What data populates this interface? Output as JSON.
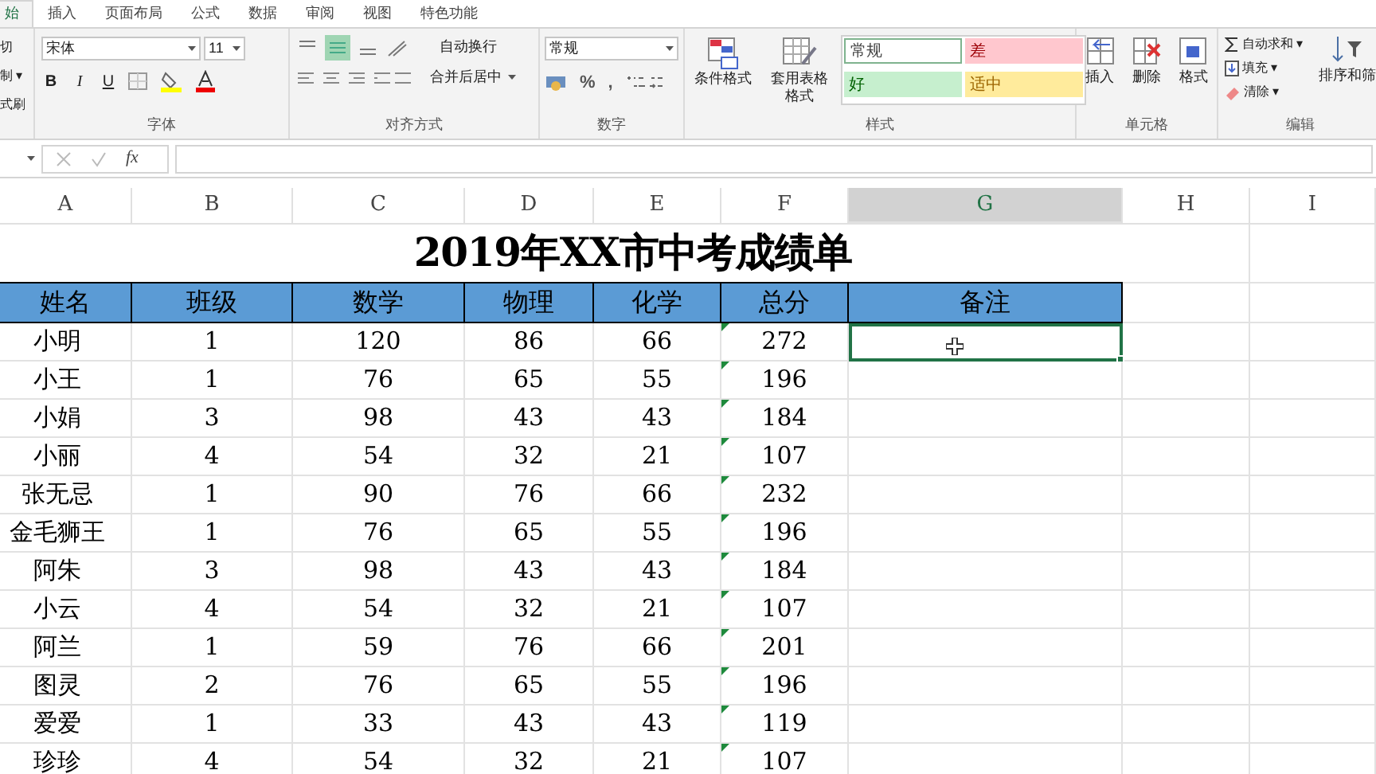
{
  "tabs": [
    {
      "label": "始",
      "selected": true
    },
    {
      "label": "插入",
      "selected": false
    },
    {
      "label": "页面布局",
      "selected": false
    },
    {
      "label": "公式",
      "selected": false
    },
    {
      "label": "数据",
      "selected": false
    },
    {
      "label": "审阅",
      "selected": false
    },
    {
      "label": "视图",
      "selected": false
    },
    {
      "label": "特色功能",
      "selected": false
    }
  ],
  "clipboard": [
    "切",
    "制 ▾",
    "式刷"
  ],
  "font": {
    "name": "宋体",
    "size": "11",
    "buttons": [
      "B",
      "I",
      "U"
    ],
    "group": "字体"
  },
  "alignment": {
    "wrap": "自动换行",
    "merge": "合并后居中",
    "group": "对齐方式"
  },
  "number": {
    "format": "常规",
    "buttons": [
      "%",
      ","
    ],
    "group": "数字"
  },
  "styles": {
    "buttons": [
      "条件格式",
      "套用表格格式"
    ],
    "cells": [
      {
        "label": "常规",
        "kind": "normal"
      },
      {
        "label": "差",
        "kind": "bad"
      },
      {
        "label": "好",
        "kind": "good"
      },
      {
        "label": "适中",
        "kind": "neutral"
      }
    ],
    "group": "样式"
  },
  "cells_group": {
    "buttons": [
      "插入",
      "删除",
      "格式"
    ],
    "group": "单元格"
  },
  "editing": {
    "items": [
      "自动求和 ▾",
      "填充 ▾",
      "清除 ▾"
    ],
    "sort": "排序和筛",
    "group": "编辑"
  },
  "formula_bar": {
    "fx": "fx"
  },
  "columns": [
    {
      "label": "A",
      "selected": false
    },
    {
      "label": "B",
      "selected": false
    },
    {
      "label": "C",
      "selected": false
    },
    {
      "label": "D",
      "selected": false
    },
    {
      "label": "E",
      "selected": false
    },
    {
      "label": "F",
      "selected": false
    },
    {
      "label": "G",
      "selected": true
    },
    {
      "label": "H",
      "selected": false
    },
    {
      "label": "I",
      "selected": false
    }
  ],
  "title": "2019年XX市中考成绩单",
  "headers": [
    "姓名",
    "班级",
    "数学",
    "物理",
    "化学",
    "总分",
    "备注"
  ],
  "rows": [
    {
      "cells": [
        "小明",
        "1",
        "120",
        "86",
        "66",
        "272"
      ],
      "selected_note": true,
      "warning": true
    },
    {
      "cells": [
        "小王",
        "1",
        "76",
        "65",
        "55",
        "196"
      ],
      "selected_note": false,
      "warning": true
    },
    {
      "cells": [
        "小娟",
        "3",
        "98",
        "43",
        "43",
        "184"
      ],
      "selected_note": false,
      "warning": true
    },
    {
      "cells": [
        "小丽",
        "4",
        "54",
        "32",
        "21",
        "107"
      ],
      "selected_note": false,
      "warning": true
    },
    {
      "cells": [
        "张无忌",
        "1",
        "90",
        "76",
        "66",
        "232"
      ],
      "selected_note": false,
      "warning": true
    },
    {
      "cells": [
        "金毛狮王",
        "1",
        "76",
        "65",
        "55",
        "196"
      ],
      "selected_note": false,
      "warning": true
    },
    {
      "cells": [
        "阿朱",
        "3",
        "98",
        "43",
        "43",
        "184"
      ],
      "selected_note": false,
      "warning": true
    },
    {
      "cells": [
        "小云",
        "4",
        "54",
        "32",
        "21",
        "107"
      ],
      "selected_note": false,
      "warning": true
    },
    {
      "cells": [
        "阿兰",
        "1",
        "59",
        "76",
        "66",
        "201"
      ],
      "selected_note": false,
      "warning": true
    },
    {
      "cells": [
        "图灵",
        "2",
        "76",
        "65",
        "55",
        "196"
      ],
      "selected_note": false,
      "warning": true
    },
    {
      "cells": [
        "爱爱",
        "1",
        "33",
        "43",
        "43",
        "119"
      ],
      "selected_note": false,
      "warning": true
    },
    {
      "cells": [
        "珍珍",
        "4",
        "54",
        "32",
        "21",
        "107"
      ],
      "selected_note": false,
      "warning": true
    }
  ]
}
